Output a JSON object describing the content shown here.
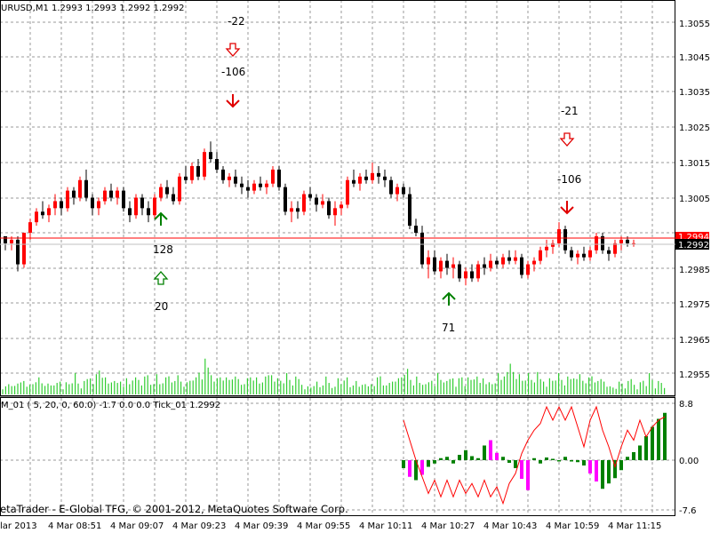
{
  "main_chart": {
    "symbol_label": "URUSD,M1  1.2993 1.2993 1.2992 1.2992",
    "price_ticks": [
      "1.3055",
      "1.3045",
      "1.3035",
      "1.3025",
      "1.3015",
      "1.3005",
      "1.2995",
      "1.2985",
      "1.2975",
      "1.2965",
      "1.2955"
    ],
    "current_price": "1.2992",
    "marker_price": "1.2994",
    "colors": {
      "bull": "#ff0000",
      "bear": "#000000",
      "signal_down": "#e00000",
      "signal_up": "#008000",
      "volume": "#32cd32",
      "grid": "#9a9a9a"
    },
    "annotations": [
      {
        "text": "-22",
        "icon": "hollow-down-arrow-icon"
      },
      {
        "text": "-106",
        "icon": "down-arrow-icon"
      },
      {
        "text": "128",
        "icon": "up-arrow-icon"
      },
      {
        "text": "20",
        "icon": "hollow-up-arrow-icon"
      },
      {
        "text": "71",
        "icon": "up-arrow-icon"
      },
      {
        "text": "-21",
        "icon": "hollow-down-arrow-icon"
      },
      {
        "text": "-106",
        "icon": "down-arrow-icon"
      }
    ]
  },
  "sub_chart": {
    "label": "M_01 ( 5, 20, 0, 60.0) -1.7 0.0 0.0  Tick_01 1.2992",
    "ticks": [
      "8.8",
      "0.00",
      "-7.6"
    ]
  },
  "watermark": "etaTrader - E-Global TFG, © 2001-2012, MetaQuotes Software Corp.",
  "time_axis": [
    "lar 2013",
    "4 Mar 08:51",
    "4 Mar 09:07",
    "4 Mar 09:23",
    "4 Mar 09:39",
    "4 Mar 09:55",
    "4 Mar 10:11",
    "4 Mar 10:27",
    "4 Mar 10:43",
    "4 Mar 10:59",
    "4 Mar 11:15"
  ],
  "chart_data": {
    "type": "candlestick",
    "title": "URUSD,M1",
    "ylim": [
      1.295,
      1.306
    ],
    "grid": true,
    "candles_ohlc": [
      [
        1.2994,
        1.2994,
        1.299,
        1.2992
      ],
      [
        1.2992,
        1.2994,
        1.299,
        1.2993
      ],
      [
        1.2993,
        1.2994,
        1.2984,
        1.2986
      ],
      [
        1.2986,
        1.2995,
        1.2985,
        1.2995
      ],
      [
        1.2995,
        1.2999,
        1.2993,
        1.2998
      ],
      [
        1.2998,
        1.3002,
        1.2997,
        1.3001
      ],
      [
        1.3001,
        1.3004,
        1.2999,
        1.3
      ],
      [
        1.3,
        1.3003,
        1.2998,
        1.3002
      ],
      [
        1.3002,
        1.3006,
        1.3,
        1.3004
      ],
      [
        1.3004,
        1.3005,
        1.3,
        1.3002
      ],
      [
        1.3002,
        1.3008,
        1.3001,
        1.3007
      ],
      [
        1.3007,
        1.3008,
        1.3003,
        1.3005
      ],
      [
        1.3005,
        1.3011,
        1.3004,
        1.301
      ],
      [
        1.301,
        1.3013,
        1.3004,
        1.3005
      ],
      [
        1.3005,
        1.3006,
        1.3,
        1.3002
      ],
      [
        1.3002,
        1.3005,
        1.3,
        1.3004
      ],
      [
        1.3004,
        1.3008,
        1.3003,
        1.3007
      ],
      [
        1.3007,
        1.3009,
        1.3004,
        1.3005
      ],
      [
        1.3005,
        1.3008,
        1.3003,
        1.3007
      ],
      [
        1.3007,
        1.3008,
        1.3001,
        1.3002
      ],
      [
        1.3002,
        1.3004,
        1.2998,
        1.3
      ],
      [
        1.3,
        1.3006,
        1.2999,
        1.3005
      ],
      [
        1.3005,
        1.3006,
        1.3,
        1.3002
      ],
      [
        1.3002,
        1.3004,
        1.2998,
        1.3
      ],
      [
        1.3,
        1.3006,
        1.2999,
        1.3005
      ],
      [
        1.3005,
        1.3009,
        1.3004,
        1.3008
      ],
      [
        1.3008,
        1.301,
        1.3005,
        1.3006
      ],
      [
        1.3006,
        1.3008,
        1.3003,
        1.3004
      ],
      [
        1.3004,
        1.3012,
        1.3003,
        1.3011
      ],
      [
        1.3011,
        1.3014,
        1.3009,
        1.301
      ],
      [
        1.301,
        1.3015,
        1.3009,
        1.3014
      ],
      [
        1.3014,
        1.3016,
        1.301,
        1.3011
      ],
      [
        1.3011,
        1.3019,
        1.301,
        1.3018
      ],
      [
        1.3018,
        1.3021,
        1.3015,
        1.3016
      ],
      [
        1.3016,
        1.3018,
        1.3012,
        1.3013
      ],
      [
        1.3013,
        1.3014,
        1.3009,
        1.301
      ],
      [
        1.301,
        1.3012,
        1.3008,
        1.3011
      ],
      [
        1.3011,
        1.3013,
        1.3008,
        1.3009
      ],
      [
        1.3009,
        1.3011,
        1.3006,
        1.3008
      ],
      [
        1.3008,
        1.301,
        1.3005,
        1.3007
      ],
      [
        1.3007,
        1.301,
        1.3006,
        1.3009
      ],
      [
        1.3009,
        1.3011,
        1.3007,
        1.3008
      ],
      [
        1.3008,
        1.301,
        1.3006,
        1.3009
      ],
      [
        1.3009,
        1.3014,
        1.3008,
        1.3013
      ],
      [
        1.3013,
        1.3014,
        1.3007,
        1.3008
      ],
      [
        1.3008,
        1.3009,
        1.3,
        1.3001
      ],
      [
        1.3001,
        1.3004,
        1.2998,
        1.3002
      ],
      [
        1.3002,
        1.3004,
        1.2999,
        1.3001
      ],
      [
        1.3001,
        1.3007,
        1.3,
        1.3006
      ],
      [
        1.3006,
        1.3008,
        1.3004,
        1.3005
      ],
      [
        1.3005,
        1.3006,
        1.3001,
        1.3003
      ],
      [
        1.3003,
        1.3006,
        1.3002,
        1.3004
      ],
      [
        1.3004,
        1.3005,
        1.2999,
        1.3
      ],
      [
        1.3,
        1.3004,
        1.2997,
        1.3002
      ],
      [
        1.3002,
        1.3004,
        1.3,
        1.3003
      ],
      [
        1.3003,
        1.3011,
        1.3002,
        1.301
      ],
      [
        1.301,
        1.3013,
        1.3008,
        1.3009
      ],
      [
        1.3009,
        1.3012,
        1.3007,
        1.3011
      ],
      [
        1.3011,
        1.3013,
        1.3009,
        1.301
      ],
      [
        1.301,
        1.3015,
        1.3009,
        1.3012
      ],
      [
        1.3012,
        1.3014,
        1.3009,
        1.3011
      ],
      [
        1.3011,
        1.3013,
        1.3008,
        1.301
      ],
      [
        1.301,
        1.3011,
        1.3005,
        1.3006
      ],
      [
        1.3006,
        1.3009,
        1.3004,
        1.3008
      ],
      [
        1.3008,
        1.3009,
        1.3005,
        1.3006
      ],
      [
        1.3006,
        1.3008,
        1.2996,
        1.2997
      ],
      [
        1.2997,
        1.2999,
        1.2994,
        1.2995
      ],
      [
        1.2995,
        1.2997,
        1.2985,
        1.2986
      ],
      [
        1.2986,
        1.299,
        1.2982,
        1.2988
      ],
      [
        1.2988,
        1.299,
        1.2983,
        1.2984
      ],
      [
        1.2984,
        1.2988,
        1.2982,
        1.2987
      ],
      [
        1.2987,
        1.2989,
        1.2983,
        1.2985
      ],
      [
        1.2985,
        1.2988,
        1.2982,
        1.2986
      ],
      [
        1.2986,
        1.2987,
        1.2981,
        1.2982
      ],
      [
        1.2982,
        1.2985,
        1.298,
        1.2984
      ],
      [
        1.2984,
        1.2986,
        1.2981,
        1.2982
      ],
      [
        1.2982,
        1.2987,
        1.2981,
        1.2986
      ],
      [
        1.2986,
        1.2988,
        1.2983,
        1.2985
      ],
      [
        1.2985,
        1.2989,
        1.2984,
        1.2987
      ],
      [
        1.2987,
        1.2988,
        1.2985,
        1.2986
      ],
      [
        1.2986,
        1.2989,
        1.2985,
        1.2988
      ],
      [
        1.2988,
        1.299,
        1.2986,
        1.2987
      ],
      [
        1.2987,
        1.299,
        1.2986,
        1.2988
      ],
      [
        1.2988,
        1.2989,
        1.2982,
        1.2983
      ],
      [
        1.2983,
        1.2987,
        1.2982,
        1.2986
      ],
      [
        1.2986,
        1.2988,
        1.2984,
        1.2987
      ],
      [
        1.2987,
        1.2991,
        1.2986,
        1.299
      ],
      [
        1.299,
        1.2993,
        1.2988,
        1.2991
      ],
      [
        1.2991,
        1.2993,
        1.2989,
        1.2992
      ],
      [
        1.2992,
        1.2998,
        1.2991,
        1.2996
      ],
      [
        1.2996,
        1.2997,
        1.2989,
        1.299
      ],
      [
        1.299,
        1.2991,
        1.2987,
        1.2988
      ],
      [
        1.2988,
        1.299,
        1.2986,
        1.2989
      ],
      [
        1.2989,
        1.2991,
        1.2987,
        1.2988
      ],
      [
        1.2988,
        1.2991,
        1.2987,
        1.299
      ],
      [
        1.299,
        1.2995,
        1.2989,
        1.2994
      ],
      [
        1.2994,
        1.2995,
        1.2989,
        1.299
      ],
      [
        1.299,
        1.2991,
        1.2987,
        1.2989
      ],
      [
        1.2989,
        1.2993,
        1.2988,
        1.2992
      ],
      [
        1.2992,
        1.2994,
        1.299,
        1.2993
      ],
      [
        1.2993,
        1.2994,
        1.2991,
        1.2992
      ],
      [
        1.2992,
        1.2993,
        1.2991,
        1.2992
      ]
    ],
    "volumes": [
      2,
      2,
      3,
      3,
      2,
      3,
      4,
      3,
      2,
      3,
      4,
      3,
      5,
      4,
      2,
      3,
      3,
      2,
      3,
      4,
      2,
      3,
      3,
      4,
      5,
      3,
      2,
      3,
      4,
      5,
      4,
      5,
      7,
      6,
      4,
      3,
      4,
      3,
      3,
      4,
      3,
      4,
      3,
      5,
      4,
      4,
      3,
      4,
      5,
      3,
      4,
      5,
      3,
      4,
      4,
      5,
      4,
      3,
      5,
      4,
      3,
      3,
      4,
      5,
      4,
      6,
      5,
      8,
      7,
      6,
      5,
      4,
      5,
      5,
      4,
      4,
      5,
      4,
      4,
      3,
      4,
      4,
      5,
      5,
      4,
      3,
      4,
      4,
      5,
      6,
      5,
      4,
      4,
      4,
      5,
      4,
      3,
      4,
      4,
      3,
      2
    ],
    "oscillator": {
      "histogram": [
        0,
        0,
        0,
        0,
        0,
        0,
        0,
        0,
        0,
        0,
        0,
        0,
        0,
        0,
        0,
        0,
        0,
        0,
        0,
        0,
        0,
        0,
        0,
        0,
        0,
        0,
        0,
        0,
        0,
        0,
        0,
        0,
        0,
        0,
        0,
        0,
        0,
        0,
        0,
        0,
        0,
        0,
        0,
        0,
        0,
        0,
        0,
        0,
        0,
        0,
        0,
        0,
        0,
        0,
        0,
        0,
        0,
        0,
        0,
        0,
        0,
        0,
        0,
        0,
        -1.2,
        -2.5,
        -3.0,
        -2.2,
        -1.0,
        -0.5,
        0.3,
        0.5,
        -0.5,
        0.8,
        1.5,
        0.6,
        0.3,
        2.2,
        3.0,
        1.1,
        0.5,
        -0.4,
        -1.2,
        -2.8,
        -4.5,
        0.3,
        -0.5,
        0.4,
        0.2,
        -0.2,
        0.5,
        -0.2,
        -0.3,
        -0.8,
        -2.0,
        -3.2,
        -4.3,
        -3.5,
        -2.7,
        -1.5,
        0.5,
        1.2,
        2.2,
        3.6,
        5.0,
        6.2,
        7.1,
        6.6,
        3.4,
        1.5,
        -0.4,
        -0.4,
        -0.9
      ],
      "highlighted_bars": [
        65,
        67,
        78,
        79,
        83,
        84,
        94,
        95,
        107
      ],
      "line": [
        0,
        0,
        0,
        0,
        0,
        0,
        0,
        0,
        0,
        0,
        0,
        0,
        0,
        0,
        0,
        0,
        0,
        0,
        0,
        0,
        0,
        0,
        0,
        0,
        0,
        0,
        0,
        0,
        0,
        0,
        0,
        0,
        0,
        0,
        0,
        0,
        0,
        0,
        0,
        0,
        0,
        0,
        0,
        0,
        0,
        0,
        0,
        0,
        0,
        0,
        0,
        0,
        0,
        0,
        0,
        0,
        0,
        0,
        0,
        0,
        0,
        0,
        0,
        0,
        6.0,
        3.0,
        0.0,
        -2.5,
        -5.0,
        -3.0,
        -5.5,
        -3.0,
        -5.5,
        -3.0,
        -5.0,
        -3.5,
        -5.5,
        -3.0,
        -5.5,
        -4.0,
        -6.5,
        -3.5,
        -2.0,
        1.0,
        3.0,
        4.5,
        5.5,
        8.0,
        6.0,
        8.0,
        6.0,
        8.0,
        5.0,
        2.0,
        6.0,
        8.0,
        4.5,
        2.0,
        -1.0,
        2.0,
        4.5,
        3.0,
        6.0,
        3.5,
        5.0,
        6.0,
        6.5,
        4.0,
        6.0,
        3.5,
        2.5,
        1.0,
        3.0,
        1.0
      ]
    }
  }
}
